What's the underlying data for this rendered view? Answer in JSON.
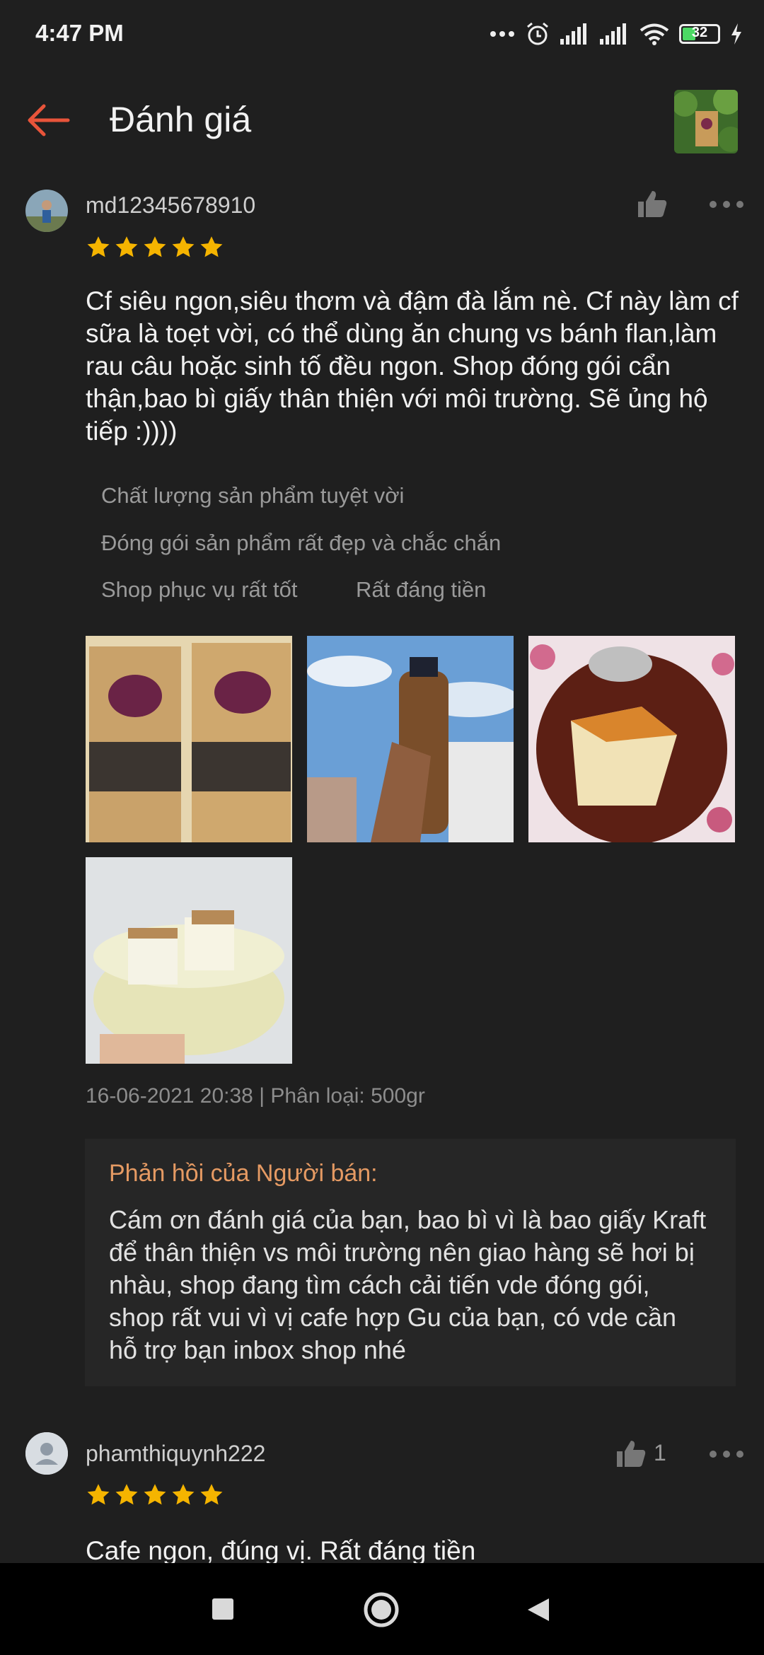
{
  "status_bar": {
    "time": "4:47 PM",
    "battery": "32",
    "icons": [
      "more-dots-icon",
      "alarm-icon",
      "signal-icon",
      "signal-icon",
      "wifi-icon",
      "battery-icon",
      "charging-icon"
    ]
  },
  "header": {
    "title": "Đánh giá",
    "back_icon": "arrow-left-icon",
    "accent_color": "#e8543a"
  },
  "reviews": [
    {
      "username": "md12345678910",
      "rating": 5,
      "likes": "",
      "text": "Cf siêu ngon,siêu thơm và đậm đà lắm nè. Cf này làm cf sữa là toẹt vời, có thể dùng ăn chung vs bánh flan,làm rau câu hoặc sinh tố đều ngon. Shop đóng gói cẩn thận,bao bì giấy thân thiện với môi trường. Sẽ ủng hộ tiếp :))))",
      "tags": [
        "Chất lượng sản phẩm tuyệt vời",
        "Đóng gói sản phẩm rất đẹp và chắc chắn",
        "Shop phục vụ rất tốt",
        "Rất đáng tiền"
      ],
      "meta": "16-06-2021 20:38 | Phân loại: 500gr",
      "seller_reply": {
        "title": "Phản hồi của Người bán:",
        "text": "Cám ơn đánh giá của bạn, bao bì vì là bao giấy Kraft để thân thiện vs môi trường nên giao hàng sẽ hơi bị nhàu, shop đang tìm cách cải tiến vde đóng gói, shop rất vui vì vị cafe hợp Gu của bạn, có vde cần hỗ trợ bạn inbox shop nhé"
      }
    },
    {
      "username": "phamthiquynh222",
      "rating": 5,
      "likes": "1",
      "text": "Cafe ngon, đúng vị. Rất đáng tiền"
    }
  ],
  "star_color": "#f5b400"
}
